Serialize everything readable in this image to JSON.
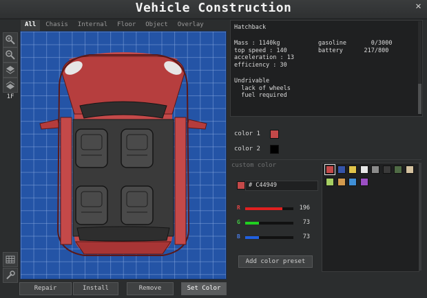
{
  "window": {
    "title": "Vehicle Construction",
    "close_glyph": "✕"
  },
  "toolbar": {
    "floor_label": "1F",
    "icons": [
      "zoom-in-icon",
      "zoom-out-icon",
      "layer-up-icon",
      "layer-down-icon",
      "grid-icon",
      "wrench-icon"
    ]
  },
  "tabs": [
    {
      "label": "All",
      "active": true
    },
    {
      "label": "Chasis",
      "active": false
    },
    {
      "label": "Internal",
      "active": false
    },
    {
      "label": "Floor",
      "active": false
    },
    {
      "label": "Object",
      "active": false
    },
    {
      "label": "Overlay",
      "active": false
    }
  ],
  "actions": {
    "repair": "Repair",
    "install": "Install",
    "remove": "Remove",
    "set_color": "Set Color"
  },
  "info": {
    "name": "Hatchback",
    "stats_left": "Mass : 1140kg\ntop speed : 140\nacceleration : 13\nefficiency : 30",
    "stats_right": "gasoline       0/3000\nbattery      217/800",
    "status": "Undrivable\n  lack of wheels\n  fuel required"
  },
  "colors": {
    "color1_label": "color 1",
    "color1": "#C44949",
    "color2_label": "color 2",
    "color2": "#000000"
  },
  "custom": {
    "label": "custom color",
    "hex_text": "# C44949",
    "r_label": "R",
    "r": 196,
    "g_label": "G",
    "g": 73,
    "b_label": "B",
    "b": 73,
    "preset_button": "Add color preset"
  },
  "palette": [
    "#C44949",
    "#3554a8",
    "#e0c44a",
    "#e6e6e6",
    "#8a8a8a",
    "#3a3a3a",
    "#4f6b45",
    "#d4c2a0",
    "#a6cf63",
    "#d39a4e",
    "#3f8fd6",
    "#9b4fc4"
  ]
}
